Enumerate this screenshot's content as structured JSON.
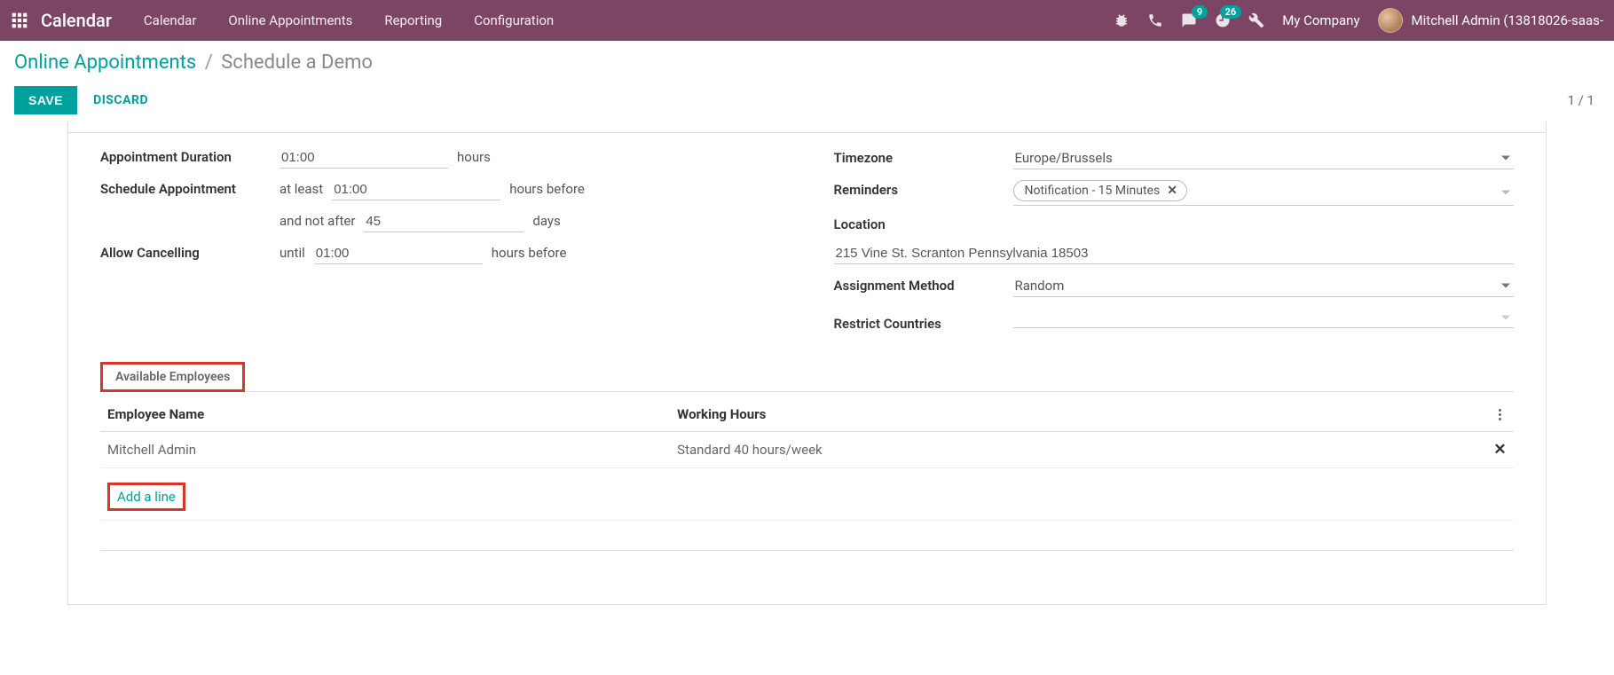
{
  "navbar": {
    "app_title": "Calendar",
    "menu": [
      "Calendar",
      "Online Appointments",
      "Reporting",
      "Configuration"
    ],
    "messages_badge": "9",
    "activities_badge": "26",
    "company": "My Company",
    "username": "Mitchell Admin (13818026-saas-"
  },
  "breadcrumb": {
    "parent": "Online Appointments",
    "current": "Schedule a Demo"
  },
  "actions": {
    "save_label": "SAVE",
    "discard_label": "DISCARD",
    "pager": "1 / 1"
  },
  "form": {
    "left": {
      "appointment_duration_label": "Appointment Duration",
      "appointment_duration_value": "01:00",
      "appointment_duration_unit": "hours",
      "schedule_label": "Schedule Appointment",
      "schedule_prefix_atleast": "at least",
      "schedule_min_value": "01:00",
      "schedule_min_unit": "hours before",
      "schedule_prefix_notafter": "and not after",
      "schedule_max_value": "45",
      "schedule_max_unit": "days",
      "allow_cancel_label": "Allow Cancelling",
      "allow_cancel_prefix": "until",
      "allow_cancel_value": "01:00",
      "allow_cancel_unit": "hours before"
    },
    "right": {
      "timezone_label": "Timezone",
      "timezone_value": "Europe/Brussels",
      "reminders_label": "Reminders",
      "reminders_tag": "Notification - 15 Minutes",
      "location_label": "Location",
      "location_value": "215 Vine St. Scranton Pennsylvania 18503",
      "assignment_label": "Assignment Method",
      "assignment_value": "Random",
      "restrict_label": "Restrict Countries",
      "restrict_value": ""
    }
  },
  "employees": {
    "section_title": "Available Employees",
    "columns": {
      "name": "Employee Name",
      "hours": "Working Hours"
    },
    "rows": [
      {
        "name": "Mitchell Admin",
        "hours": "Standard 40 hours/week"
      }
    ],
    "add_line_label": "Add a line"
  }
}
